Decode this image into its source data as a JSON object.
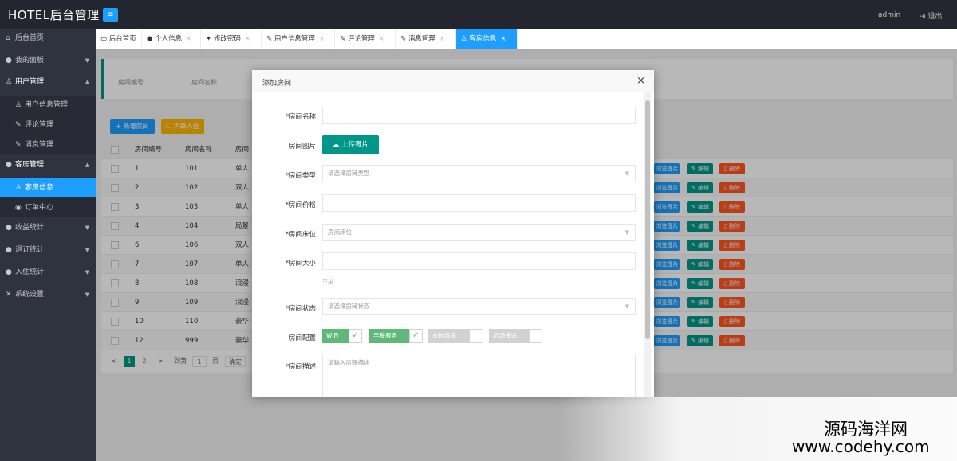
{
  "header": {
    "brand": "HOTEL后台管理",
    "menu_toggle": "≡",
    "admin": "admin",
    "logout": "退出"
  },
  "sidebar": {
    "items": [
      {
        "icon": "home-icon",
        "glyph": "⌂",
        "label": "后台首页"
      },
      {
        "icon": "user-icon",
        "glyph": "●",
        "label": "我的面板"
      },
      {
        "icon": "users-icon",
        "glyph": "♙",
        "label": "用户管理"
      },
      {
        "icon": "users-icon",
        "glyph": "♙",
        "label": "用户信息管理"
      },
      {
        "icon": "edit-icon",
        "glyph": "✎",
        "label": "评论管理"
      },
      {
        "icon": "edit-icon",
        "glyph": "✎",
        "label": "消息管理"
      },
      {
        "icon": "room-icon",
        "glyph": "●",
        "label": "客房管理"
      },
      {
        "icon": "users-icon",
        "glyph": "♙",
        "label": "客房信息"
      },
      {
        "icon": "target-icon",
        "glyph": "◉",
        "label": "订单中心"
      },
      {
        "icon": "chart-icon",
        "glyph": "●",
        "label": "收益统计"
      },
      {
        "icon": "chart-icon",
        "glyph": "●",
        "label": "退订统计"
      },
      {
        "icon": "chart-icon",
        "glyph": "●",
        "label": "入住统计"
      },
      {
        "icon": "tools-icon",
        "glyph": "✕",
        "label": "系统设置"
      }
    ]
  },
  "tabs": [
    {
      "icon": "monitor-icon",
      "glyph": "▭",
      "label": "后台首页"
    },
    {
      "icon": "user-icon",
      "glyph": "●",
      "label": "个人信息"
    },
    {
      "icon": "wrench-icon",
      "glyph": "✦",
      "label": "修改密码"
    },
    {
      "icon": "edit-icon",
      "glyph": "✎",
      "label": "用户信息管理"
    },
    {
      "icon": "edit-icon",
      "glyph": "✎",
      "label": "评论管理"
    },
    {
      "icon": "edit-icon",
      "glyph": "✎",
      "label": "消息管理"
    },
    {
      "icon": "users-icon",
      "glyph": "♙",
      "label": "客房信息"
    }
  ],
  "search": {
    "label_id": "房间编号",
    "label_name": "房间名称"
  },
  "toolbar": {
    "add": "+ 新增房间",
    "batch": "☐ 内联入住"
  },
  "table": {
    "headers": [
      "房间编号",
      "房间名称",
      "房间"
    ],
    "rows": [
      {
        "id": "1",
        "name": "101",
        "type": "单人"
      },
      {
        "id": "2",
        "name": "102",
        "type": "双人"
      },
      {
        "id": "3",
        "name": "103",
        "type": "单人"
      },
      {
        "id": "4",
        "name": "104",
        "type": "局景"
      },
      {
        "id": "6",
        "name": "106",
        "type": "双人"
      },
      {
        "id": "7",
        "name": "107",
        "type": "单人"
      },
      {
        "id": "8",
        "name": "108",
        "type": "浪漫"
      },
      {
        "id": "9",
        "name": "109",
        "type": "浪漫"
      },
      {
        "id": "10",
        "name": "110",
        "type": "豪华"
      },
      {
        "id": "12",
        "name": "999",
        "type": "豪华"
      }
    ],
    "actions": {
      "image": "浏览图片",
      "edit": "✎ 编辑",
      "delete": "▯ 删除"
    }
  },
  "pager": {
    "prev": "<",
    "current": "1",
    "next_page": "2",
    "next": ">",
    "goto": "到第",
    "page_value": "1",
    "page_unit": "页",
    "confirm": "确定"
  },
  "modal": {
    "title": "添加房间",
    "close": "×",
    "fields": {
      "name_label": "*房间名称",
      "image_label": "房间图片",
      "upload": "上传图片",
      "type_label": "*房间类型",
      "type_placeholder": "请选择房间类型",
      "price_label": "*房间价格",
      "bed_label": "*房间床位",
      "bed_placeholder": "房间床位",
      "size_label": "*房间大小",
      "size_unit": "平米",
      "status_label": "*房间状态",
      "status_placeholder": "请选择房间状态",
      "config_label": "房间配置",
      "desc_label": "*房间描述",
      "desc_placeholder": "请输入房间描述"
    },
    "config_options": [
      {
        "label": "WiFi",
        "checked": true
      },
      {
        "label": "早餐服务",
        "checked": true
      },
      {
        "label": "衣物清洗",
        "checked": false
      },
      {
        "label": "机场接送",
        "checked": false
      }
    ]
  },
  "watermark": {
    "line1": "源码海洋网",
    "line2": "www.codehy.com"
  }
}
